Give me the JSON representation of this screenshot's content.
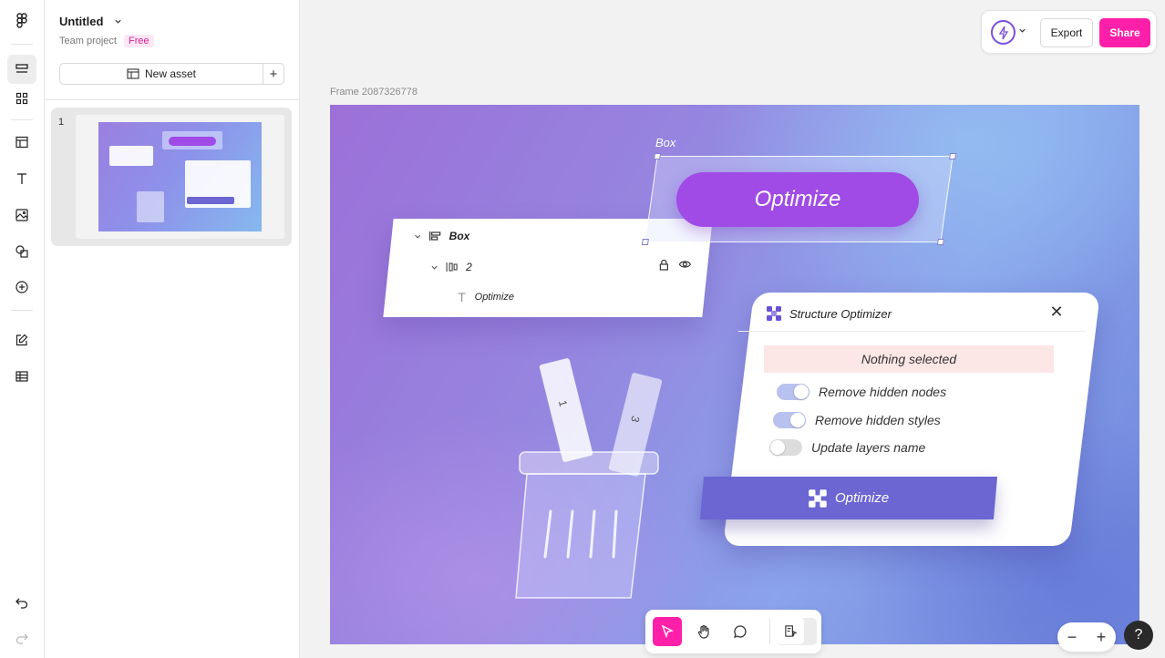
{
  "project": {
    "title": "Untitled",
    "team": "Team project",
    "plan_badge": "Free"
  },
  "panel": {
    "new_asset_label": "New asset",
    "page_number": "1"
  },
  "canvas": {
    "frame_name": "Frame 2087326778",
    "box_label": "Box",
    "optimize_pill": "Optimize",
    "layers": {
      "root": "Box",
      "child": "2",
      "leaf": "Optimize"
    },
    "stick_labels": [
      "1",
      "3"
    ],
    "optimizer": {
      "title": "Structure Optimizer",
      "status": "Nothing selected",
      "options": [
        {
          "label": "Remove hidden nodes",
          "checked": true
        },
        {
          "label": "Remove hidden styles",
          "checked": true
        },
        {
          "label": "Update layers name",
          "checked": false
        }
      ],
      "button": "Optimize"
    }
  },
  "topbar": {
    "export": "Export",
    "share": "Share"
  },
  "zoom": {
    "minus": "−",
    "plus": "+"
  },
  "help": "?",
  "colors": {
    "accent": "#ff1fa9",
    "pill": "#a04be6",
    "optimize_button": "#6b66d2"
  }
}
